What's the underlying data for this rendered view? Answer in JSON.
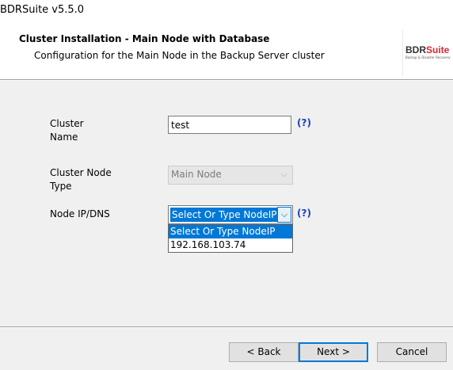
{
  "window": {
    "title": "BDRSuite v5.5.0"
  },
  "header": {
    "title": "Cluster Installation - Main Node with Database",
    "subtitle": "Configuration for the Main Node in the Backup Server cluster",
    "logo_word_main": "BDR",
    "logo_word_accent": "Suite",
    "logo_tagline": "Backup & Disaster Recovery"
  },
  "form": {
    "cluster_name": {
      "label_line1": "Cluster",
      "label_line2": "Name",
      "value": "test",
      "help": "(?)"
    },
    "cluster_node_type": {
      "label_line1": "Cluster Node",
      "label_line2": "Type",
      "value": "Main Node"
    },
    "node_ip": {
      "label": "Node IP/DNS",
      "value": "Select Or Type NodeIP",
      "help": "(?)",
      "options": [
        "Select Or Type NodeIP",
        "192.168.103.74"
      ]
    }
  },
  "icons": {
    "dropdown_chevron": "⌵"
  },
  "buttons": {
    "back": "< Back",
    "next": "Next >",
    "cancel": "Cancel"
  },
  "colors": {
    "selection": "#0078d7",
    "help_link": "#1a3dbf",
    "logo_accent": "#d9232d"
  }
}
